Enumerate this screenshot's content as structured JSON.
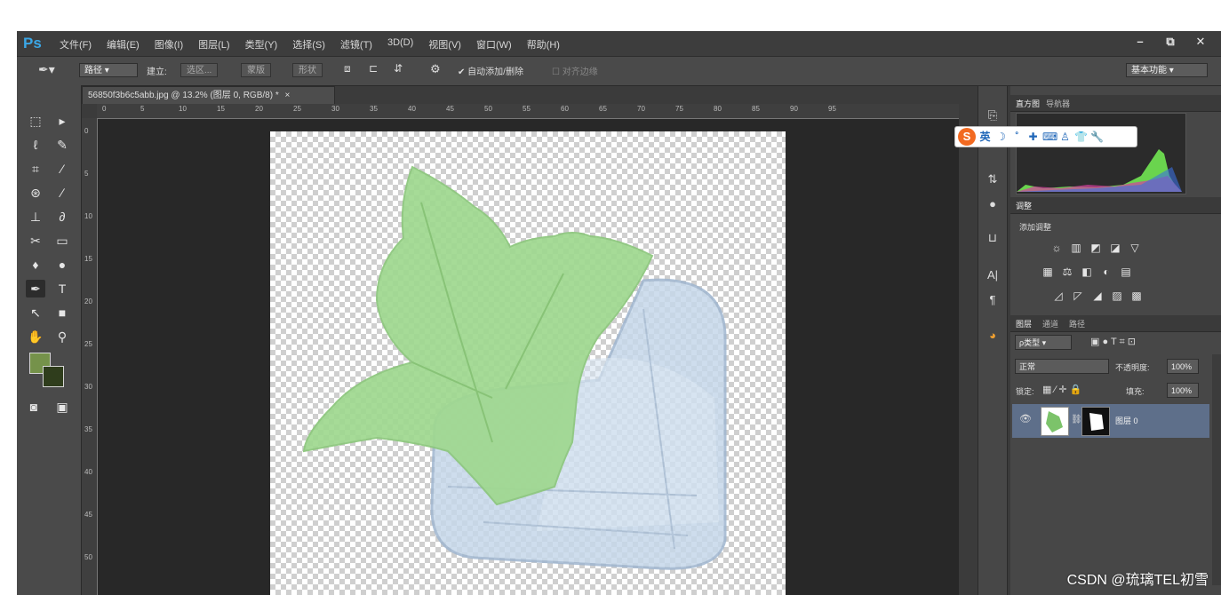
{
  "app": {
    "logo": "Ps"
  },
  "menubar": {
    "items": [
      "文件(F)",
      "编辑(E)",
      "图像(I)",
      "图层(L)",
      "类型(Y)",
      "选择(S)",
      "滤镜(T)",
      "3D(D)",
      "视图(V)",
      "窗口(W)",
      "帮助(H)"
    ],
    "window_buttons": [
      "–",
      "⧉",
      "✕"
    ]
  },
  "options": {
    "tool_mode": "路径",
    "build_label": "建立:",
    "selection_btn": "选区...",
    "mask_btn": "蒙版",
    "shape_btn": "形状",
    "auto_add_label": "自动添加/删除",
    "align_edges_label": "对齐边缘",
    "workspace": "基本功能"
  },
  "document": {
    "tab_title": "56850f3b6c5abb.jpg @ 13.2% (图层 0, RGB/8) *",
    "tab_close": "×",
    "ruler_top": [
      "0",
      "5",
      "10",
      "15",
      "20",
      "25",
      "30",
      "35",
      "40",
      "45",
      "50",
      "55",
      "60",
      "65",
      "70",
      "75",
      "80",
      "85",
      "90",
      "95"
    ],
    "ruler_left": [
      "0",
      "5",
      "10",
      "15",
      "20",
      "25",
      "30",
      "35",
      "40",
      "45",
      "50"
    ]
  },
  "panels": {
    "histogram_tabs": [
      "直方图",
      "导航器"
    ],
    "adjust_tab": "调整",
    "adjust_title": "添加调整",
    "adjust_icons_row1": [
      "☼",
      "▥",
      "◩",
      "◪",
      "▽"
    ],
    "adjust_icons_row2": [
      "▦",
      "⚖",
      "◧",
      "◐",
      "▤"
    ],
    "adjust_icons_row3": [
      "◿",
      "◸",
      "◢",
      "▨",
      "▩"
    ],
    "layers_tabs": [
      "图层",
      "通道",
      "路径"
    ],
    "filter_kind": "ρ类型",
    "blend_mode": "正常",
    "opacity_label": "不透明度:",
    "opacity_value": "100%",
    "lock_label": "锁定:",
    "fill_label": "填充:",
    "fill_value": "100%",
    "layer_name": "图层 0"
  },
  "ime": {
    "logo": "S",
    "mode": "英"
  },
  "watermark": "CSDN @琉璃TEL初雪",
  "colors": {
    "foreground": "#75924a",
    "background": "#2f3d1c",
    "leaf": "#9fd88f",
    "ice": "#bcd0e6",
    "selected_layer": "#5e6f8a"
  }
}
